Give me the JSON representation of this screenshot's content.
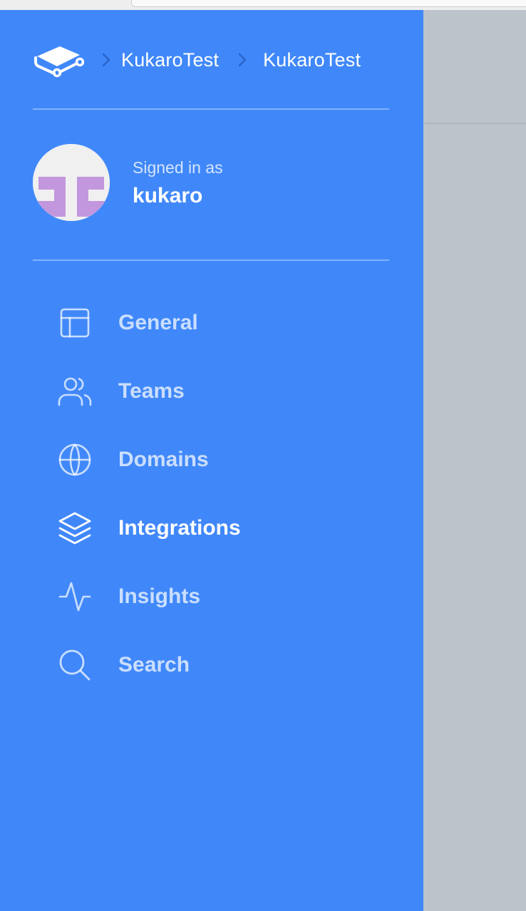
{
  "breadcrumb": {
    "items": [
      "KukaroTest",
      "KukaroTest"
    ]
  },
  "profile": {
    "signed_in_label": "Signed in as",
    "username": "kukaro"
  },
  "nav": {
    "items": [
      {
        "label": "General",
        "icon": "layout-icon"
      },
      {
        "label": "Teams",
        "icon": "users-icon"
      },
      {
        "label": "Domains",
        "icon": "globe-icon"
      },
      {
        "label": "Integrations",
        "icon": "layers-icon",
        "active": true
      },
      {
        "label": "Insights",
        "icon": "activity-icon"
      },
      {
        "label": "Search",
        "icon": "search-icon"
      }
    ]
  },
  "colors": {
    "sidebar_bg": "#4088fa",
    "overlay_bg": "#bdc3cb",
    "avatar_accent": "#c297dd"
  }
}
